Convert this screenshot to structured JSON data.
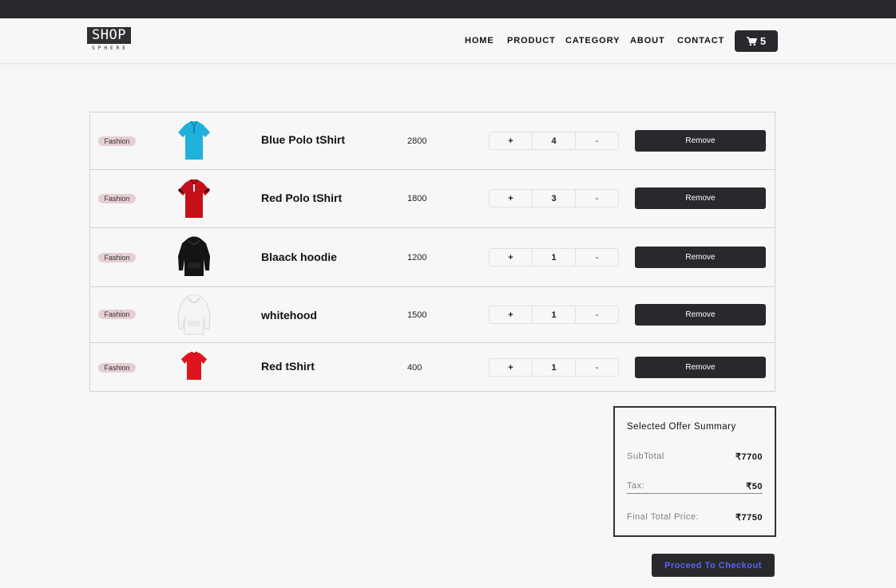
{
  "brand": {
    "top": "SHOP",
    "bottom": "SPHERE"
  },
  "nav": {
    "items": [
      "HOME",
      "PRODUCT",
      "CATEGORY",
      "ABOUT",
      "CONTACT"
    ]
  },
  "cart": {
    "count": "5",
    "icon": "shopping-cart-icon"
  },
  "cart_items": [
    {
      "category": "Fashion",
      "name": "Blue Polo tShirt",
      "price": "2800",
      "qty": "4",
      "plus": "+",
      "minus": "-",
      "remove": "Remove",
      "image": "blue-polo-image",
      "color": "#1fb0dc"
    },
    {
      "category": "Fashion",
      "name": "Red Polo tShirt",
      "price": "1800",
      "qty": "3",
      "plus": "+",
      "minus": "-",
      "remove": "Remove",
      "image": "red-polo-image",
      "color": "#c4101a"
    },
    {
      "category": "Fashion",
      "name": "Blaack hoodie",
      "price": "1200",
      "qty": "1",
      "plus": "+",
      "minus": "-",
      "remove": "Remove",
      "image": "black-hoodie-image",
      "color": "#141414"
    },
    {
      "category": "Fashion",
      "name": "whitehood",
      "price": "1500",
      "qty": "1",
      "plus": "+",
      "minus": "-",
      "remove": "Remove",
      "image": "white-hoodie-image",
      "color": "#f1f1f1"
    },
    {
      "category": "Fashion",
      "name": "Red tShirt",
      "price": "400",
      "qty": "1",
      "plus": "+",
      "minus": "-",
      "remove": "Remove",
      "image": "red-tshirt-image",
      "color": "#e0141e"
    }
  ],
  "summary": {
    "title": "Selected Offer Summary",
    "subtotal_label": "SubTotal",
    "subtotal_value": "₹7700",
    "tax_label": "Tax:",
    "tax_value": "₹50",
    "final_label": "Final Total Price:",
    "final_value": "₹7750"
  },
  "checkout": {
    "label": "Proceed To Checkout"
  },
  "colors": {
    "dark": "#28292d",
    "checkout_text": "#5a63f5",
    "badge_bg": "#e6cfd2",
    "page_bg": "#f7f7f7"
  }
}
